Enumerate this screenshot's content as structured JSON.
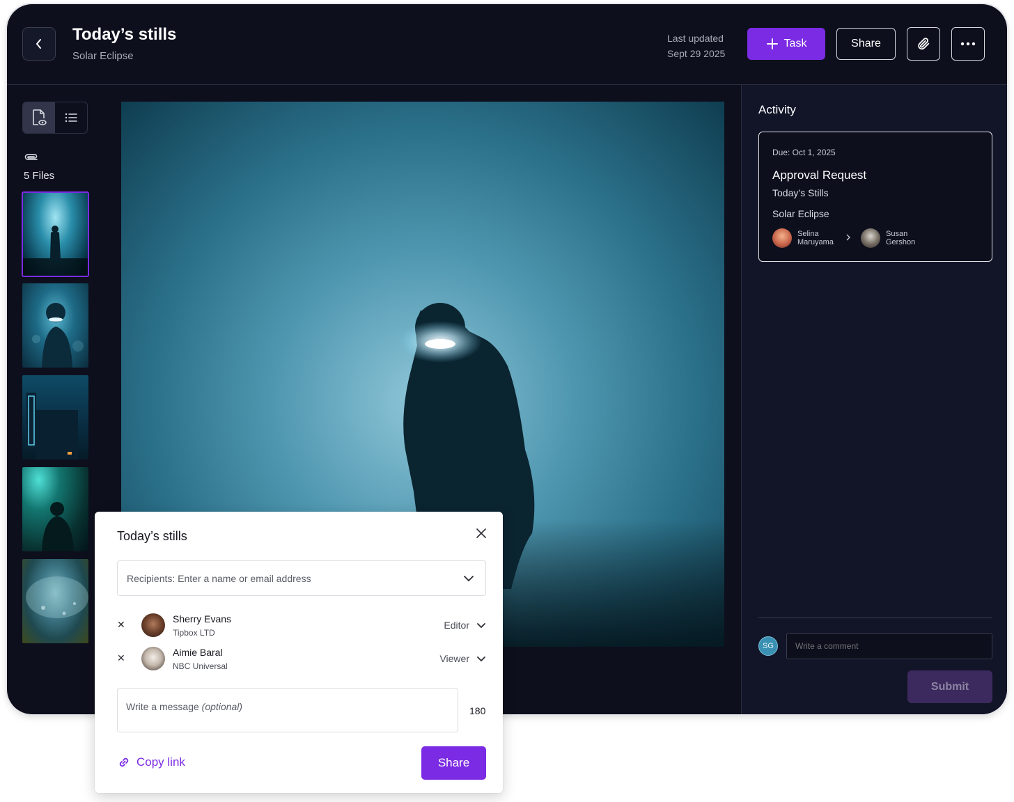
{
  "header": {
    "title": "Today’s stills",
    "subtitle": "Solar Eclipse",
    "last_updated_label": "Last updated",
    "last_updated_date": "Sept 29 2025",
    "task_label": "Task",
    "share_label": "Share"
  },
  "sidebar": {
    "files_count": "5 Files",
    "view_modes": [
      "preview",
      "list"
    ],
    "selected_file": 1
  },
  "activity": {
    "title": "Activity",
    "card": {
      "due": "Due: Oct 1, 2025",
      "title": "Approval Request",
      "item": "Today’s Stills",
      "project": "Solar Eclipse",
      "from_first": "Selina",
      "from_last": "Maruyama",
      "to_first": "Susan",
      "to_last": "Gershon"
    },
    "user_initials": "SG",
    "comment_placeholder": "Write a comment",
    "submit_label": "Submit"
  },
  "share_dialog": {
    "title": "Today’s stills",
    "recipients_placeholder": "Recipients: Enter a name or email address",
    "people": [
      {
        "name": "Sherry Evans",
        "org": "Tipbox LTD",
        "role": "Editor"
      },
      {
        "name": "Aimie Baral",
        "org": "NBC Universal",
        "role": "Viewer"
      }
    ],
    "message_placeholder": "Write a message",
    "message_optional": "(optional)",
    "char_count": "180",
    "copy_link_label": "Copy link",
    "share_label": "Share"
  },
  "colors": {
    "accent": "#7b2be3",
    "background": "#0d0f1d",
    "panel": "#121428",
    "submit_disabled": "#3c2a5e"
  }
}
